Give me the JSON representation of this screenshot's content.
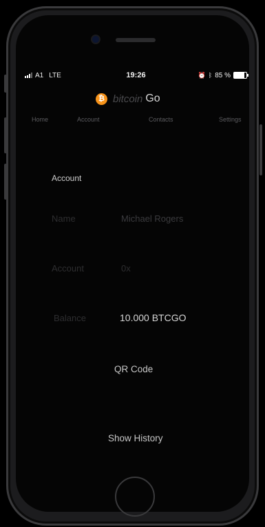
{
  "status": {
    "carrier": "A1",
    "network": "LTE",
    "time": "19:26",
    "battery": "85 %",
    "battery_level": 0.85,
    "alarm_icon": "alarm-clock-icon",
    "bluetooth_icon": "bluetooth-icon"
  },
  "header": {
    "logo_symbol": "₿",
    "logo_text": "bitcoin",
    "logo_suffix": "Go",
    "accent": "#f7931a"
  },
  "nav": {
    "home": "Home",
    "account": "Account",
    "contacts": "Contacts",
    "settings": "Settings"
  },
  "account": {
    "section_title": "Account",
    "name_label": "Name",
    "name_value": "Michael Rogers",
    "account_label": "Account",
    "account_value": "0x",
    "balance_label": "Balance",
    "balance_value": "10.000 BTCGO"
  },
  "actions": {
    "qr_code": "QR Code",
    "show_history": "Show History"
  }
}
